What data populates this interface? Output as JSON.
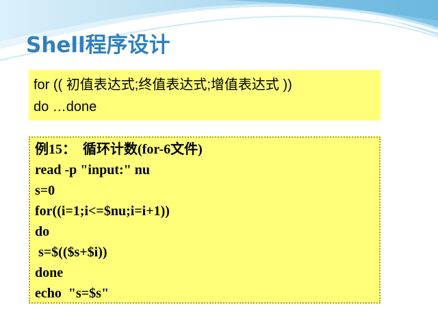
{
  "slide": {
    "title": "Shell程序设计"
  },
  "syntax": {
    "lines": [
      "for  (( 初值表达式;终值表达式;增值表达式 ))",
      "do …done"
    ]
  },
  "example": {
    "lines": [
      "例15：  循环计数(for-6文件)",
      "read -p \"input:\" nu",
      "s=0",
      "for((i=1;i<=$nu;i=i+1))",
      "do",
      " s=$(($s+$i))",
      "done",
      "echo  \"s=$s\""
    ]
  },
  "colors": {
    "title": "#2f7fbf",
    "box_fill": "#ffff79",
    "box_border": "#a6a22a",
    "decor_blue": "#8ecbe8"
  }
}
